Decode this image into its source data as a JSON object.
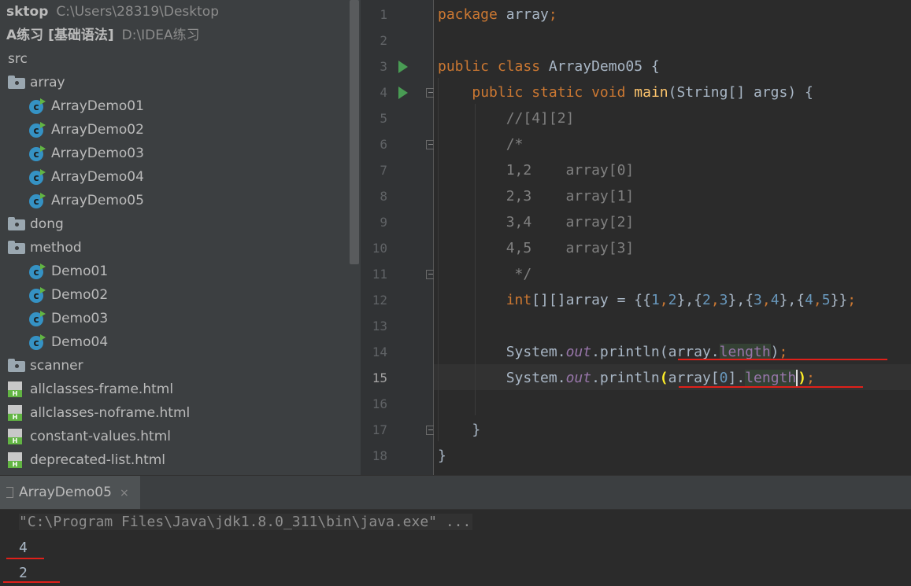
{
  "project_tree": {
    "header": [
      {
        "name": "sktop",
        "path": "C:\\Users\\28319\\Desktop"
      },
      {
        "name": "A练习 [基础语法]",
        "path": "D:\\IDEA练习"
      }
    ],
    "items": [
      {
        "label": "src",
        "type": "none",
        "indent": 0
      },
      {
        "label": "array",
        "type": "folder",
        "indent": 1
      },
      {
        "label": "ArrayDemo01",
        "type": "class",
        "indent": 2
      },
      {
        "label": "ArrayDemo02",
        "type": "class",
        "indent": 2
      },
      {
        "label": "ArrayDemo03",
        "type": "class",
        "indent": 2
      },
      {
        "label": "ArrayDemo04",
        "type": "class",
        "indent": 2
      },
      {
        "label": "ArrayDemo05",
        "type": "class",
        "indent": 2
      },
      {
        "label": "dong",
        "type": "folder",
        "indent": 1
      },
      {
        "label": "method",
        "type": "folder",
        "indent": 1
      },
      {
        "label": "Demo01",
        "type": "class",
        "indent": 2
      },
      {
        "label": "Demo02",
        "type": "class",
        "indent": 2
      },
      {
        "label": "Demo03",
        "type": "class",
        "indent": 2
      },
      {
        "label": "Demo04",
        "type": "class",
        "indent": 2
      },
      {
        "label": "scanner",
        "type": "folder",
        "indent": 1
      },
      {
        "label": "allclasses-frame.html",
        "type": "html",
        "indent": 1
      },
      {
        "label": "allclasses-noframe.html",
        "type": "html",
        "indent": 1
      },
      {
        "label": "constant-values.html",
        "type": "html",
        "indent": 1
      },
      {
        "label": "deprecated-list.html",
        "type": "html",
        "indent": 1
      }
    ],
    "class_icon_letter": "c",
    "html_icon_letter": "H"
  },
  "editor": {
    "current_line": 15,
    "run_lines": [
      3,
      4
    ],
    "fold_lines": [
      4,
      6,
      11,
      17
    ],
    "lines": [
      [
        [
          "kw",
          "package "
        ],
        [
          "p",
          "array"
        ],
        [
          "kw",
          ";"
        ]
      ],
      [],
      [
        [
          "kw",
          "public class "
        ],
        [
          "p",
          "ArrayDemo05 {"
        ]
      ],
      [
        [
          "p",
          "    "
        ],
        [
          "kw",
          "public static void "
        ],
        [
          "fn",
          "main"
        ],
        [
          "p",
          "(String[] args) {"
        ]
      ],
      [
        [
          "p",
          "        "
        ],
        [
          "cm",
          "//[4][2]"
        ]
      ],
      [
        [
          "p",
          "        "
        ],
        [
          "cm",
          "/*"
        ]
      ],
      [
        [
          "p",
          "        "
        ],
        [
          "cm",
          "1,2    array[0]"
        ]
      ],
      [
        [
          "p",
          "        "
        ],
        [
          "cm",
          "2,3    array[1]"
        ]
      ],
      [
        [
          "p",
          "        "
        ],
        [
          "cm",
          "3,4    array[2]"
        ]
      ],
      [
        [
          "p",
          "        "
        ],
        [
          "cm",
          "4,5    array[3]"
        ]
      ],
      [
        [
          "p",
          "        "
        ],
        [
          "cm",
          " */"
        ]
      ],
      [
        [
          "p",
          "        "
        ],
        [
          "kw",
          "int"
        ],
        [
          "p",
          "[][]array = {{"
        ],
        [
          "num",
          "1"
        ],
        [
          "kw",
          ","
        ],
        [
          "num",
          "2"
        ],
        [
          "p",
          "},{"
        ],
        [
          "num",
          "2"
        ],
        [
          "kw",
          ","
        ],
        [
          "num",
          "3"
        ],
        [
          "p",
          "},{"
        ],
        [
          "num",
          "3"
        ],
        [
          "kw",
          ","
        ],
        [
          "num",
          "4"
        ],
        [
          "p",
          "},{"
        ],
        [
          "num",
          "4"
        ],
        [
          "kw",
          ","
        ],
        [
          "num",
          "5"
        ],
        [
          "p",
          "}}"
        ],
        [
          "kw",
          ";"
        ]
      ],
      [],
      [
        [
          "p",
          "        System."
        ],
        [
          "st",
          "out"
        ],
        [
          "p",
          ".println(array."
        ],
        [
          "fld hl",
          "length"
        ],
        [
          "p",
          ")"
        ],
        [
          "kw",
          ";"
        ]
      ],
      [
        [
          "p",
          "        System."
        ],
        [
          "st",
          "out"
        ],
        [
          "p",
          ".println"
        ],
        [
          "br",
          "("
        ],
        [
          "p",
          "array["
        ],
        [
          "num",
          "0"
        ],
        [
          "p",
          "]."
        ],
        [
          "fld hl",
          "length"
        ],
        [
          "caret",
          ""
        ],
        [
          "br",
          ")"
        ],
        [
          "kw",
          ";"
        ]
      ],
      [],
      [
        [
          "p",
          "    }"
        ]
      ],
      [
        [
          "p",
          "}"
        ]
      ]
    ]
  },
  "run_panel": {
    "tab_label": "ArrayDemo05",
    "close_glyph": "×",
    "output": [
      "\"C:\\Program Files\\Java\\jdk1.8.0_311\\bin\\java.exe\" ...",
      "4",
      "2"
    ]
  },
  "colors": {
    "keyword": "#cc7832",
    "number": "#6897bb",
    "method": "#ffc66d",
    "comment": "#808080",
    "field": "#9876aa",
    "annotation_red": "#e0201a"
  }
}
